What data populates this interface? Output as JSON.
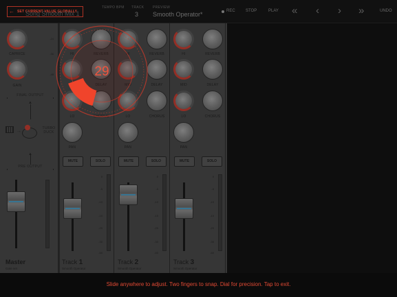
{
  "header": {
    "global_button": "SET CURRENT VALUE GLOBALLY",
    "song_name": "Song Smooth Mix 1",
    "tempo_label": "TEMPO BPM",
    "track_label": "TRACK",
    "track_value": "3",
    "preview_label": "PREVIEW",
    "preview_value": "Smooth Operator*",
    "rec_label": "REC",
    "stop_label": "STOP",
    "play_label": "PLAY",
    "rewind_icon": "«",
    "prev_icon": "‹",
    "next_icon": "›",
    "forward_icon": "»",
    "undo_label": "UNDO"
  },
  "master": {
    "caprock_label": "CAPRICE",
    "gain_label": "GAIN",
    "final_output": "FINAL OUTPUT",
    "turbo_duck": "TURBO DUCK",
    "pre_output": "PRE OUTPUT",
    "name": "Master",
    "sub": "Gate set",
    "scale_top": [
      "0",
      "-24",
      "-36",
      "-48"
    ]
  },
  "tracks": [
    {
      "prefix": "Track ",
      "number": "1",
      "sub": "Smooth Operator",
      "mute": "MUTE",
      "solo": "SOLO",
      "hi": "HI",
      "mid": "MID",
      "lo": "LO",
      "reverb": "REVERB",
      "delay": "DELAY",
      "chorus": "CHORUS",
      "pan": "PAN"
    },
    {
      "prefix": "Track ",
      "number": "2",
      "sub": "Smooth Operator",
      "mute": "MUTE",
      "solo": "SOLO",
      "hi": "HI",
      "mid": "MID",
      "lo": "LO",
      "reverb": "REVERB",
      "delay": "DELAY",
      "chorus": "CHORUS",
      "pan": "PAN"
    },
    {
      "prefix": "Track ",
      "number": "3",
      "sub": "Smooth Operator",
      "mute": "MUTE",
      "solo": "SOLO",
      "hi": "HI",
      "mid": "MID",
      "lo": "LO",
      "reverb": "REVERB",
      "delay": "DELAY",
      "chorus": "CHORUS",
      "pan": "PAN"
    }
  ],
  "scale": [
    "0",
    "-5",
    "-10",
    "-15",
    "-20",
    "-30",
    "-60"
  ],
  "dial": {
    "value": "29",
    "fraction": 0.29,
    "color": "#f0553e"
  },
  "hint": "Slide anywhere to adjust. Two fingers to snap. Dial for precision. Tap to exit.",
  "colors": {
    "accent": "#e24a34",
    "fader_line": "#3f86a8"
  }
}
